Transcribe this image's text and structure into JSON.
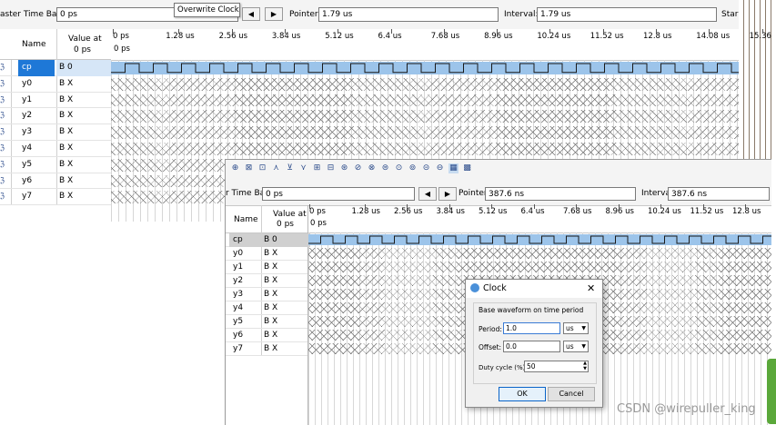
{
  "main": {
    "toolbar": {
      "master_label": "aster Time Bar:",
      "master_value": "0 ps",
      "tooltip": "Overwrite Clock",
      "prev_icon": "triangle-left-icon",
      "next_icon": "triangle-right-icon",
      "pointer_label": "Pointer:",
      "pointer_value": "1.79 us",
      "interval_label": "Interval:",
      "interval_value": "1.79 us",
      "start_label": "Star"
    },
    "header": {
      "name": "Name",
      "value_line1": "Value at",
      "value_line2": "0 ps"
    },
    "ticks": [
      "0 ps",
      "1.28 us",
      "2.56 us",
      "3.84 us",
      "5.12 us",
      "6.4 us",
      "7.68 us",
      "8.96 us",
      "10.24 us",
      "11.52 us",
      "12.8 us",
      "14.08 us",
      "15.36"
    ],
    "sub_tick": "0 ps",
    "signals": [
      {
        "name": "cp",
        "value": "B 0",
        "type": "clock",
        "selected": true
      },
      {
        "name": "y0",
        "value": "B X",
        "type": "unknown"
      },
      {
        "name": "y1",
        "value": "B X",
        "type": "unknown"
      },
      {
        "name": "y2",
        "value": "B X",
        "type": "unknown"
      },
      {
        "name": "y3",
        "value": "B X",
        "type": "unknown"
      },
      {
        "name": "y4",
        "value": "B X",
        "type": "unknown"
      },
      {
        "name": "y5",
        "value": "B X",
        "type": "unknown"
      },
      {
        "name": "y6",
        "value": "B X",
        "type": "unknown"
      },
      {
        "name": "y7",
        "value": "B X",
        "type": "unknown"
      }
    ]
  },
  "second": {
    "toolbar_icons": [
      "zoom-icon",
      "zoom-fit-icon",
      "marker-icon",
      "edge-icon",
      "bus-icon",
      "waveform-icon",
      "group-icon",
      "counter-icon",
      "constant-icon",
      "random-icon",
      "inverse-icon",
      "value-icon",
      "clock-icon",
      "overwrite-icon",
      "grid-icon",
      "snap-icon",
      "settings-icon",
      "chart-icon"
    ],
    "master_label": "r Time Bar:",
    "master_value": "0 ps",
    "pointer_label": "Pointer:",
    "pointer_value": "387.6 ns",
    "interval_label": "Interval:",
    "interval_value": "387.6 ns",
    "header": {
      "name": "Name",
      "value_line1": "Value at",
      "value_line2": "0 ps"
    },
    "ticks": [
      "0 ps",
      "1.28 us",
      "2.56 us",
      "3.84 us",
      "5.12 us",
      "6.4 us",
      "7.68 us",
      "8.96 us",
      "10.24 us",
      "11.52 us",
      "12.8 us"
    ],
    "sub_tick": "0 ps",
    "signals": [
      {
        "name": "cp",
        "value": "B 0",
        "type": "clock",
        "selected": true
      },
      {
        "name": "y0",
        "value": "B X",
        "type": "unknown"
      },
      {
        "name": "y1",
        "value": "B X",
        "type": "unknown"
      },
      {
        "name": "y2",
        "value": "B X",
        "type": "unknown"
      },
      {
        "name": "y3",
        "value": "B X",
        "type": "unknown"
      },
      {
        "name": "y4",
        "value": "B X",
        "type": "unknown"
      },
      {
        "name": "y5",
        "value": "B X",
        "type": "unknown"
      },
      {
        "name": "y6",
        "value": "B X",
        "type": "unknown"
      },
      {
        "name": "y7",
        "value": "B X",
        "type": "unknown"
      }
    ]
  },
  "dialog": {
    "title": "Clock",
    "group_label": "Base waveform on time period",
    "period_label": "Period:",
    "period_value": "1.0",
    "period_unit": "us",
    "offset_label": "Offset:",
    "offset_value": "0.0",
    "offset_unit": "us",
    "duty_label": "Duty cycle (%):",
    "duty_value": "50",
    "ok_label": "OK",
    "cancel_label": "Cancel"
  },
  "watermark": "CSDN @wirepuller_king",
  "colors": {
    "clock_fill": "#9cc4ea",
    "selected_row": "#1e78d7",
    "hatch": "#6f6f6f",
    "accent": "#0a64c8"
  }
}
